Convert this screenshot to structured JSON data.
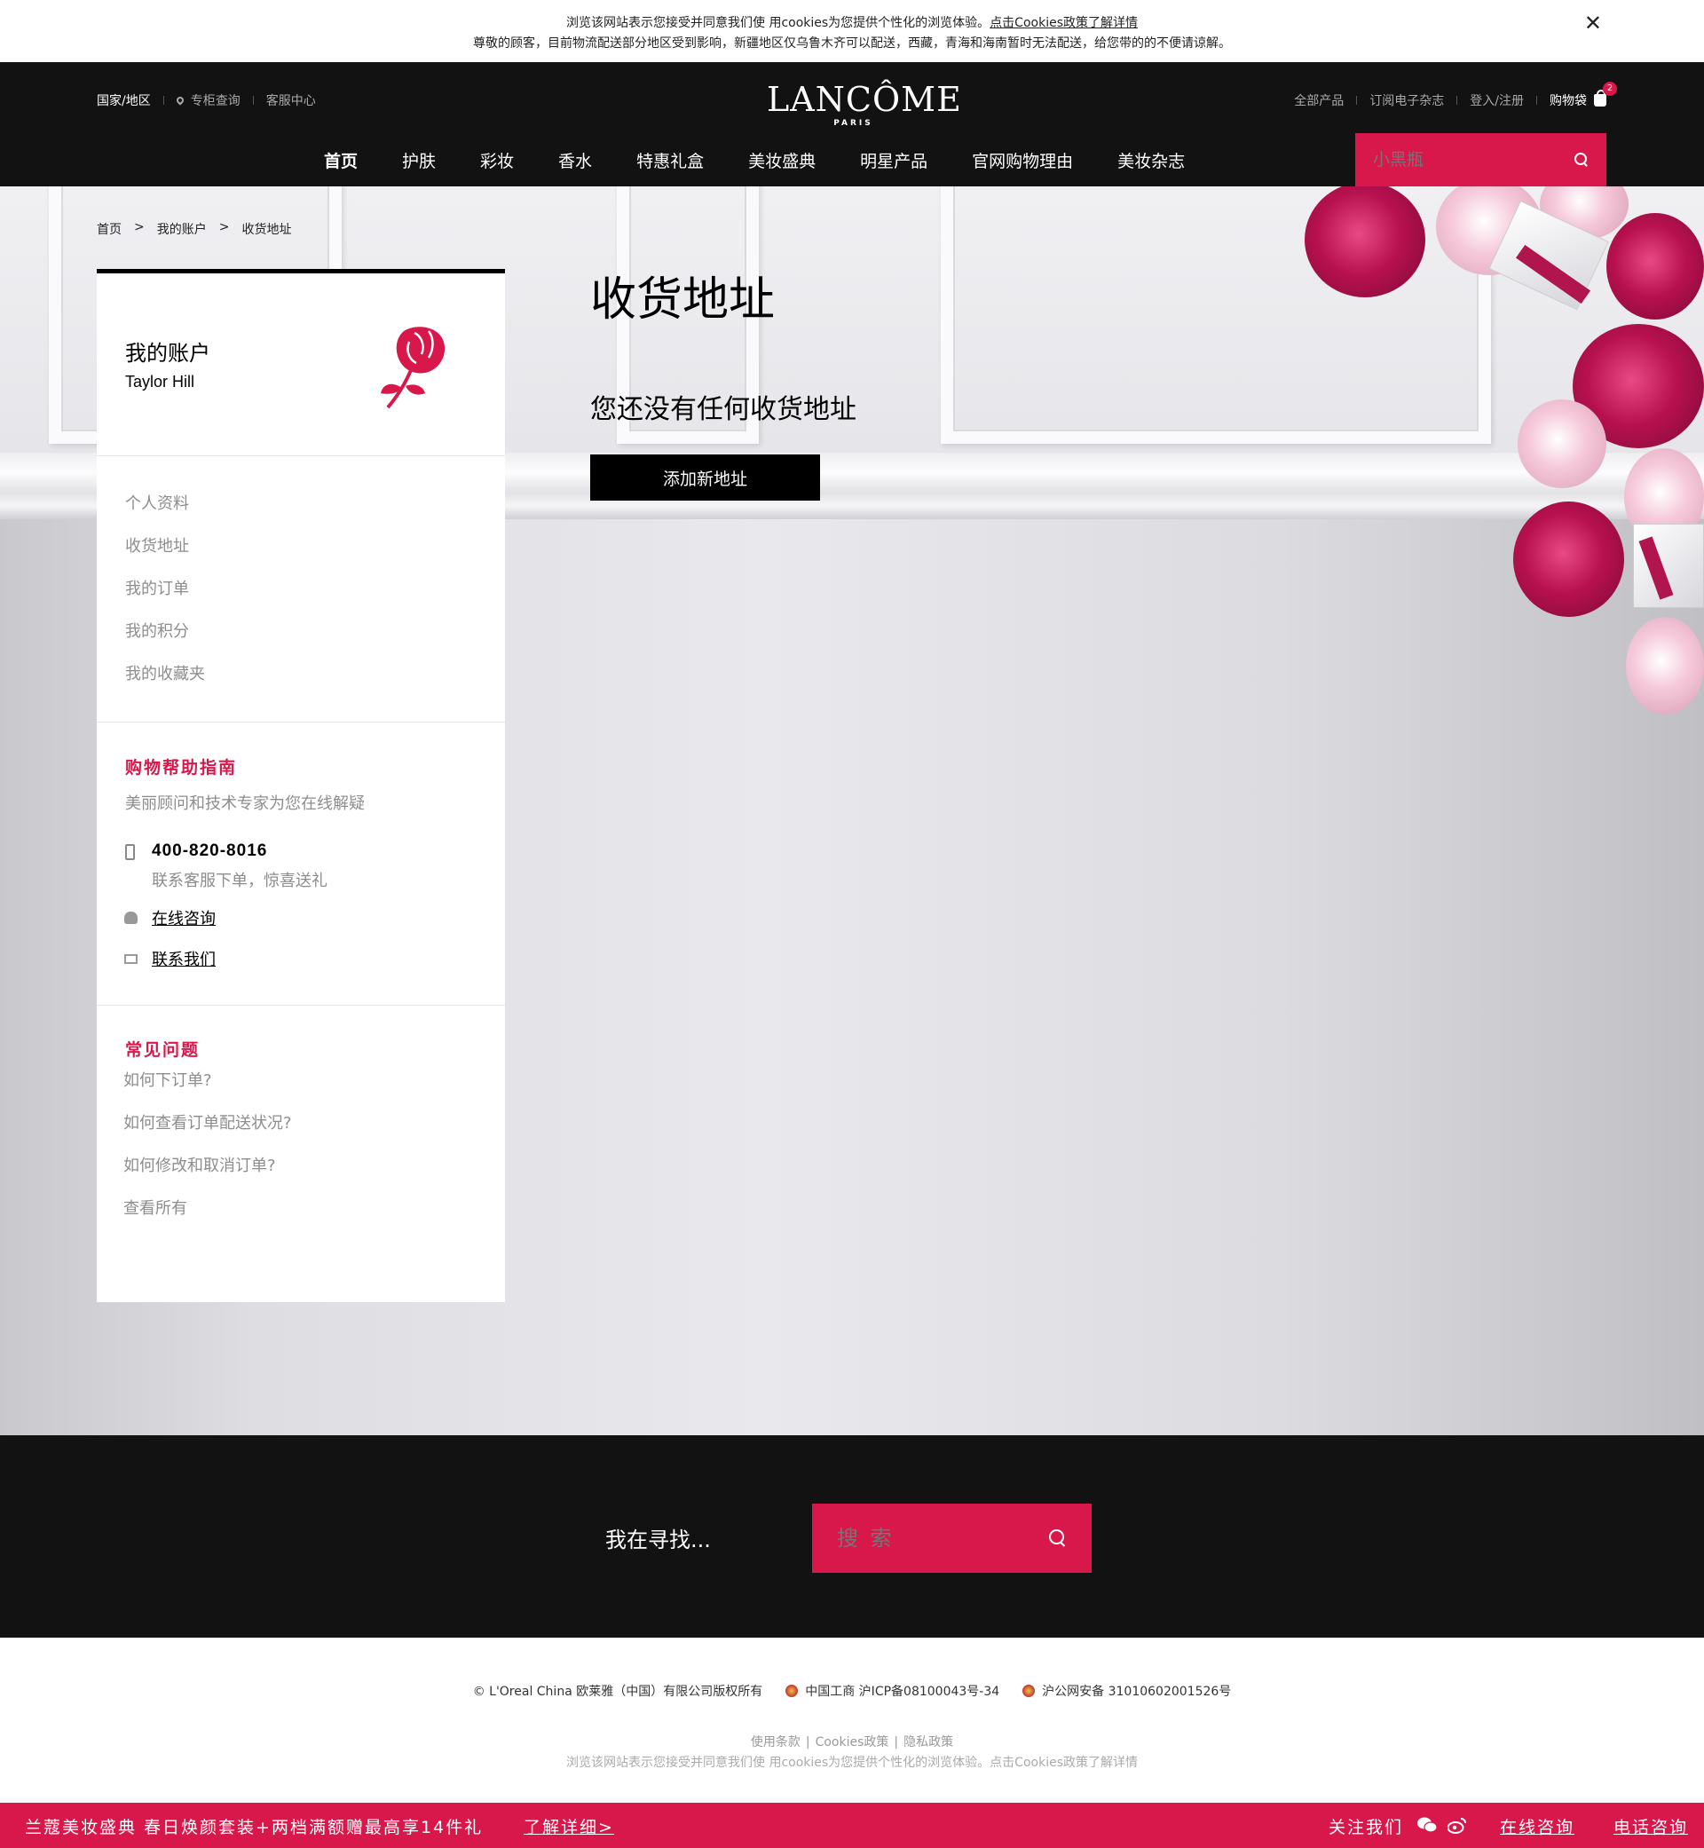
{
  "cookie": {
    "line1_prefix": "浏览该网站表示您接受并同意我们使 用cookies为您提供个性化的浏览体验。",
    "line1_link": "点击Cookies政策了解详情",
    "line2": "尊敬的顾客，目前物流配送部分地区受到影响，新疆地区仅乌鲁木齐可以配送，西藏，青海和海南暂时无法配送，给您带的的不便请谅解。",
    "close": "✕"
  },
  "header": {
    "util_left": [
      "国家/地区",
      "专柜查询",
      "客服中心"
    ],
    "logo": "LANCÔME",
    "logo_sub": "PARIS",
    "util_right": [
      "全部产品",
      "订阅电子杂志",
      "登入/注册"
    ],
    "bag_label": "购物袋",
    "bag_count": "2",
    "nav": [
      "首页",
      "护肤",
      "彩妆",
      "香水",
      "特惠礼盒",
      "美妆盛典",
      "明星产品",
      "官网购物理由",
      "美妆杂志"
    ],
    "search_placeholder": "小黑瓶"
  },
  "breadcrumb": [
    "首页",
    ">",
    "我的账户",
    ">",
    "收货地址"
  ],
  "sidebar": {
    "title": "我的账户",
    "user_name": "Taylor Hill",
    "menu": [
      "个人资料",
      "收货地址",
      "我的订单",
      "我的积分",
      "我的收藏夹"
    ],
    "help_title": "购物帮助指南",
    "help_subtitle": "美丽顾问和技术专家为您在线解疑",
    "phone": "400-820-8016",
    "phone_note": "联系客服下单，惊喜送礼",
    "chat_link": "在线咨询",
    "contact_link": "联系我们",
    "faq_title": "常见问题",
    "faq": [
      "如何下订单?",
      "如何查看订单配送状况?",
      "如何修改和取消订单?",
      "查看所有"
    ]
  },
  "content": {
    "title": "收货地址",
    "empty_message": "您还没有任何收货地址",
    "add_button": "添加新地址"
  },
  "footer_search": {
    "label": "我在寻找...",
    "placeholder": "搜 索"
  },
  "legal": {
    "copyright": "© L'Oreal China 欧莱雅（中国）有限公司版权所有",
    "icp": "中国工商 沪ICP备08100043号-34",
    "police": "沪公网安备 31010602001526号",
    "links": [
      "使用条款",
      "Cookies政策",
      "隐私政策"
    ],
    "note": "浏览该网站表示您接受并同意我们使 用cookies为您提供个性化的浏览体验。点击Cookies政策了解详情"
  },
  "promo": {
    "text": "兰蔻美妆盛典 春日焕颜套装+两档满额赠最高享14件礼",
    "more": "了解详细>",
    "follow": "关注我们",
    "chat": "在线咨询",
    "call": "电话咨询"
  },
  "colors": {
    "brand": "#d8174b",
    "header_bg": "#121212"
  },
  "icons": [
    "close-icon",
    "location-pin-icon",
    "shopping-bag-icon",
    "search-icon",
    "rose-logo-icon",
    "phone-icon",
    "chat-icon",
    "mail-icon",
    "badge-icon",
    "wechat-icon",
    "weibo-icon"
  ]
}
